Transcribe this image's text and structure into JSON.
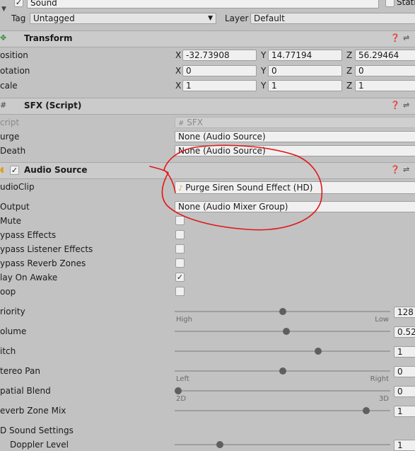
{
  "top": {
    "name": "Sound",
    "static_label": "Stati",
    "tag_label": "Tag",
    "tag_value": "Untagged",
    "layer_label": "Layer",
    "layer_value": "Default"
  },
  "transform": {
    "title": "Transform",
    "rows": [
      {
        "label": "osition",
        "x": "-32.73908",
        "y": "14.77194",
        "z": "56.29464"
      },
      {
        "label": "otation",
        "x": "0",
        "y": "0",
        "z": "0"
      },
      {
        "label": "cale",
        "x": "1",
        "y": "1",
        "z": "1"
      }
    ],
    "axis": {
      "x": "X",
      "y": "Y",
      "z": "Z"
    }
  },
  "sfx": {
    "title": "SFX (Script)",
    "script_label": "cript",
    "script_value": "SFX",
    "purge_label": "urge",
    "purge_value": "None (Audio Source)",
    "death_label": "Death",
    "death_value": "None (Audio Source)"
  },
  "audio_source": {
    "title": "Audio Source",
    "audioclip_label": "udioClip",
    "audioclip_value": "Purge Siren Sound Effect (HD)",
    "output_label": "Output",
    "output_value": "None (Audio Mixer Group)",
    "checks": [
      {
        "label": "Mute",
        "checked": false
      },
      {
        "label": "ypass Effects",
        "checked": false
      },
      {
        "label": "ypass Listener Effects",
        "checked": false
      },
      {
        "label": "ypass Reverb Zones",
        "checked": false
      },
      {
        "label": "lay On Awake",
        "checked": true
      },
      {
        "label": "oop",
        "checked": false
      }
    ],
    "sliders": [
      {
        "label": "riority",
        "value": "128",
        "level": 0.5,
        "left_hint": "High",
        "right_hint": "Low"
      },
      {
        "label": "olume",
        "value": "0.52",
        "level": 0.52,
        "left_hint": "",
        "right_hint": ""
      },
      {
        "label": "itch",
        "value": "1",
        "level": 0.67,
        "left_hint": "",
        "right_hint": ""
      },
      {
        "label": "tereo Pan",
        "value": "0",
        "level": 0.5,
        "left_hint": "Left",
        "right_hint": "Right"
      },
      {
        "label": "patial Blend",
        "value": "0",
        "level": 0.0,
        "left_hint": "2D",
        "right_hint": "3D"
      },
      {
        "label": "everb Zone Mix",
        "value": "1",
        "level": 0.9,
        "left_hint": "",
        "right_hint": ""
      }
    ],
    "settings_3d_label": "D Sound Settings",
    "doppler_label": "Doppler Level",
    "doppler_value": "1",
    "doppler_level": 0.2
  },
  "colors": {
    "annotation": "#e01818"
  }
}
